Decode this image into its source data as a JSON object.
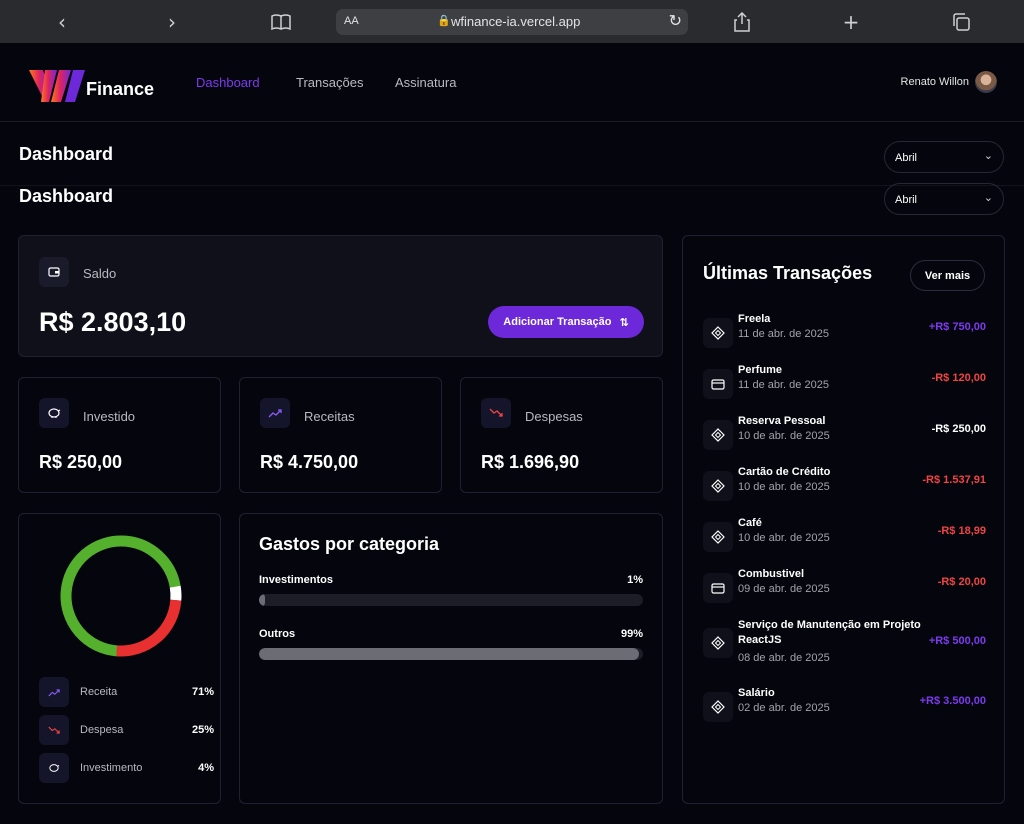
{
  "browser": {
    "aa": "AA",
    "url": "wfinance-ia.vercel.app"
  },
  "nav": {
    "brand": "Finance",
    "links": [
      "Dashboard",
      "Transações",
      "Assinatura"
    ],
    "user": "Renato Willon"
  },
  "header": {
    "title": "Dashboard",
    "month": "Abril"
  },
  "header2": {
    "title": "Dashboard",
    "month": "Abril"
  },
  "saldo": {
    "label": "Saldo",
    "value": "R$ 2.803,10",
    "button": "Adicionar Transação"
  },
  "summary": [
    {
      "label": "Investido",
      "value": "R$ 250,00",
      "icon": "piggy-bank-icon"
    },
    {
      "label": "Receitas",
      "value": "R$ 4.750,00",
      "icon": "trending-up-icon"
    },
    {
      "label": "Despesas",
      "value": "R$ 1.696,90",
      "icon": "trending-down-icon"
    }
  ],
  "pie": {
    "legend": [
      {
        "label": "Receita",
        "pct": "71%",
        "value": 71,
        "color": "#55b02e"
      },
      {
        "label": "Despesa",
        "pct": "25%",
        "value": 25,
        "color": "#e93030"
      },
      {
        "label": "Investimento",
        "pct": "4%",
        "value": 4,
        "color": "#ffffff"
      }
    ]
  },
  "gastos": {
    "title": "Gastos por categoria",
    "items": [
      {
        "name": "Investimentos",
        "pct": "1%",
        "value": 1
      },
      {
        "name": "Outros",
        "pct": "99%",
        "value": 99
      }
    ]
  },
  "transactions": {
    "title": "Últimas Transações",
    "more": "Ver mais",
    "items": [
      {
        "name": "Freela",
        "date": "11 de abr. de 2025",
        "amount": "+R$ 750,00",
        "type": "pos",
        "icon": "pix-icon"
      },
      {
        "name": "Perfume",
        "date": "11 de abr. de 2025",
        "amount": "-R$ 120,00",
        "type": "neg",
        "icon": "card-icon"
      },
      {
        "name": "Reserva Pessoal",
        "date": "10 de abr. de 2025",
        "amount": "-R$ 250,00",
        "type": "neu",
        "icon": "pix-icon"
      },
      {
        "name": "Cartão de Crédito",
        "date": "10 de abr. de 2025",
        "amount": "-R$ 1.537,91",
        "type": "neg",
        "icon": "pix-icon"
      },
      {
        "name": "Café",
        "date": "10 de abr. de 2025",
        "amount": "-R$ 18,99",
        "type": "neg",
        "icon": "pix-icon"
      },
      {
        "name": "Combustivel",
        "date": "09 de abr. de 2025",
        "amount": "-R$ 20,00",
        "type": "neg",
        "icon": "card-icon"
      },
      {
        "name": "Serviço de Manutenção em Projeto ReactJS",
        "date": "08 de abr. de 2025",
        "amount": "+R$ 500,00",
        "type": "pos",
        "icon": "pix-icon"
      },
      {
        "name": "Salário",
        "date": "02 de abr. de 2025",
        "amount": "+R$ 3.500,00",
        "type": "pos",
        "icon": "pix-icon"
      }
    ]
  }
}
